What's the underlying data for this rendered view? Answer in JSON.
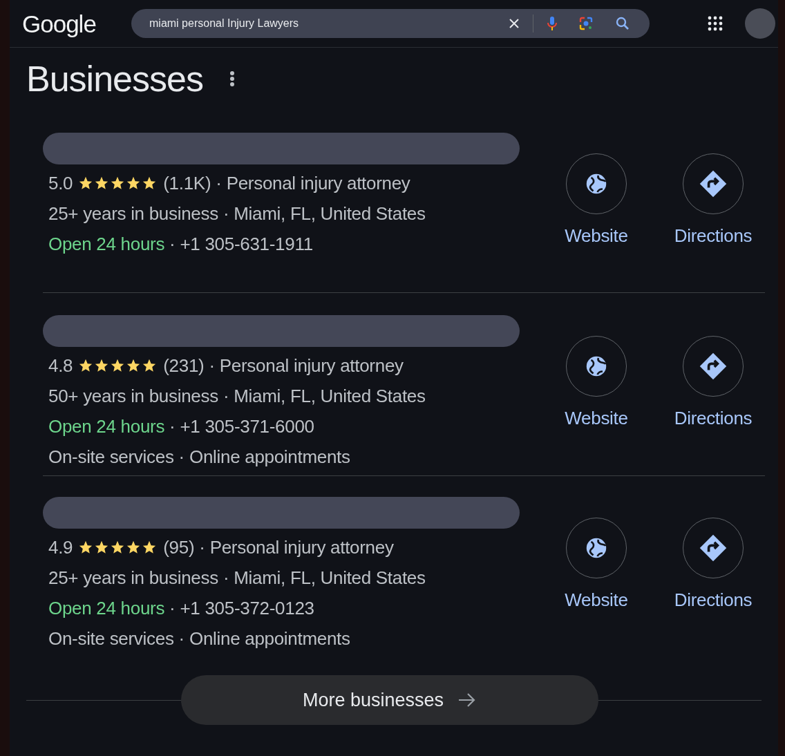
{
  "header": {
    "logo": "Google",
    "search": {
      "value": "miami personal Injury Lawyers"
    }
  },
  "section": {
    "title": "Businesses"
  },
  "results": [
    {
      "stars": 5,
      "lines": [
        [
          {
            "kind": "rating",
            "text": "5.0"
          },
          {
            "kind": "stars"
          },
          {
            "kind": "reviews",
            "text": "(1.1K)"
          },
          {
            "kind": "sep",
            "text": "·"
          },
          {
            "kind": "category",
            "text": "Personal injury attorney"
          }
        ],
        [
          {
            "kind": "years",
            "text": "25+ years in business"
          },
          {
            "kind": "sep",
            "text": "·"
          },
          {
            "kind": "location",
            "text": "Miami, FL, United States"
          }
        ],
        [
          {
            "kind": "hours",
            "text": "Open 24 hours"
          },
          {
            "kind": "sep",
            "text": "·"
          },
          {
            "kind": "phone",
            "text": "+1 305-631-1911"
          }
        ]
      ],
      "actions": [
        {
          "kind": "website",
          "label": "Website"
        },
        {
          "kind": "directions",
          "label": "Directions"
        }
      ]
    },
    {
      "stars": 5,
      "lines": [
        [
          {
            "kind": "rating",
            "text": "4.8"
          },
          {
            "kind": "stars"
          },
          {
            "kind": "reviews",
            "text": "(231)"
          },
          {
            "kind": "sep",
            "text": "·"
          },
          {
            "kind": "category",
            "text": "Personal injury attorney"
          }
        ],
        [
          {
            "kind": "years",
            "text": "50+ years in business"
          },
          {
            "kind": "sep",
            "text": "·"
          },
          {
            "kind": "location",
            "text": "Miami, FL, United States"
          }
        ],
        [
          {
            "kind": "hours",
            "text": "Open 24 hours"
          },
          {
            "kind": "sep",
            "text": "·"
          },
          {
            "kind": "phone",
            "text": "+1 305-371-6000"
          }
        ],
        [
          {
            "kind": "service",
            "text": "On-site services"
          },
          {
            "kind": "sep",
            "text": "·"
          },
          {
            "kind": "service",
            "text": "Online appointments"
          }
        ]
      ],
      "actions": [
        {
          "kind": "website",
          "label": "Website"
        },
        {
          "kind": "directions",
          "label": "Directions"
        }
      ]
    },
    {
      "stars": 5,
      "lines": [
        [
          {
            "kind": "rating",
            "text": "4.9"
          },
          {
            "kind": "stars"
          },
          {
            "kind": "reviews",
            "text": "(95)"
          },
          {
            "kind": "sep",
            "text": "·"
          },
          {
            "kind": "category",
            "text": "Personal injury attorney"
          }
        ],
        [
          {
            "kind": "years",
            "text": "25+ years in business"
          },
          {
            "kind": "sep",
            "text": "·"
          },
          {
            "kind": "location",
            "text": "Miami, FL, United States"
          }
        ],
        [
          {
            "kind": "hours",
            "text": "Open 24 hours"
          },
          {
            "kind": "sep",
            "text": "·"
          },
          {
            "kind": "phone",
            "text": "+1 305-372-0123"
          }
        ],
        [
          {
            "kind": "service",
            "text": "On-site services"
          },
          {
            "kind": "sep",
            "text": "·"
          },
          {
            "kind": "service",
            "text": "Online appointments"
          }
        ]
      ],
      "actions": [
        {
          "kind": "website",
          "label": "Website"
        },
        {
          "kind": "directions",
          "label": "Directions"
        }
      ]
    }
  ],
  "more_button": {
    "label": "More businesses"
  }
}
